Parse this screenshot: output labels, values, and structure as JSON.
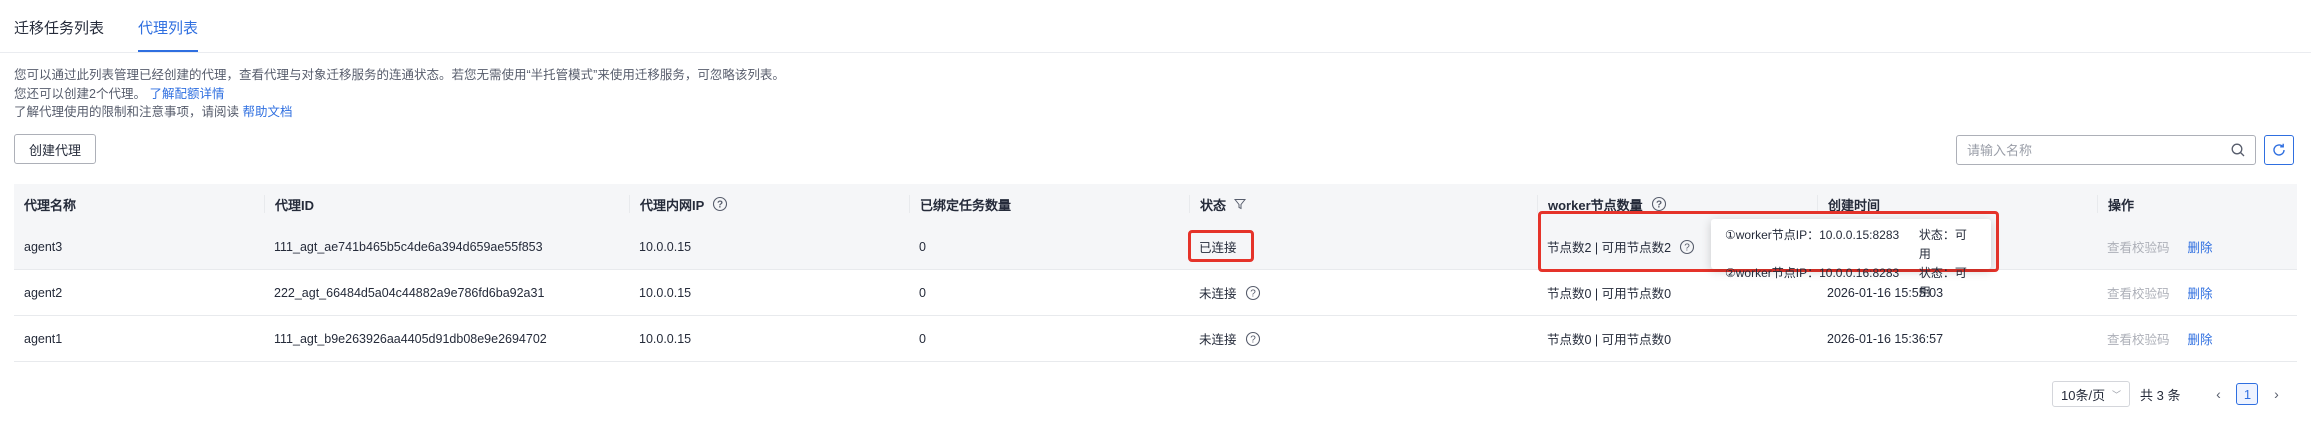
{
  "tabs": [
    {
      "label": "迁移任务列表",
      "active": false
    },
    {
      "label": "代理列表",
      "active": true
    }
  ],
  "description": {
    "line1": "您可以通过此列表管理已经创建的代理，查看代理与对象迁移服务的连通状态。若您无需使用“半托管模式”来使用迁移服务，可忽略该列表。",
    "line2_text": "您还可以创建2个代理。",
    "line2_link": "了解配额详情",
    "line3_text": "了解代理使用的限制和注意事项，请阅读",
    "line3_link": "帮助文档"
  },
  "toolbar": {
    "create_label": "创建代理",
    "search_placeholder": "请输入名称",
    "search_icon": "search-icon",
    "refresh_icon": "refresh-icon"
  },
  "table": {
    "headers": [
      "代理名称",
      "代理ID",
      "代理内网IP",
      "已绑定任务数量",
      "状态",
      "worker节点数量",
      "创建时间",
      "操作"
    ],
    "rows": [
      {
        "name": "agent3",
        "id": "111_agt_ae741b465b5c4de6a394d659ae55f853",
        "ip": "10.0.0.15",
        "bound": "0",
        "status": "已连接",
        "workers": "节点数2 | 可用节点数2",
        "created": "",
        "action_view": "查看校验码",
        "action_delete": "删除"
      },
      {
        "name": "agent2",
        "id": "222_agt_66484d5a04c44882a9e786fd6ba92a31",
        "ip": "10.0.0.15",
        "bound": "0",
        "status": "未连接",
        "workers": "节点数0 | 可用节点数0",
        "created": "2026-01-16 15:55:03",
        "action_view": "查看校验码",
        "action_delete": "删除"
      },
      {
        "name": "agent1",
        "id": "111_agt_b9e263926aa4405d91db08e9e2694702",
        "ip": "10.0.0.15",
        "bound": "0",
        "status": "未连接",
        "workers": "节点数0 | 可用节点数0",
        "created": "2026-01-16 15:36:57",
        "action_view": "查看校验码",
        "action_delete": "删除"
      }
    ]
  },
  "tooltip": {
    "w1_ip": "①worker节点IP：10.0.0.15:8283",
    "w1_status": "状态：可用",
    "w2_ip": "②worker节点IP：10.0.0.16:8283",
    "w2_status": "状态：可用"
  },
  "pagination": {
    "page_size": "10条/页",
    "total": "共 3 条",
    "current_page": "1"
  },
  "colors": {
    "accent": "#2f6fe0",
    "highlight": "#e5332a"
  }
}
